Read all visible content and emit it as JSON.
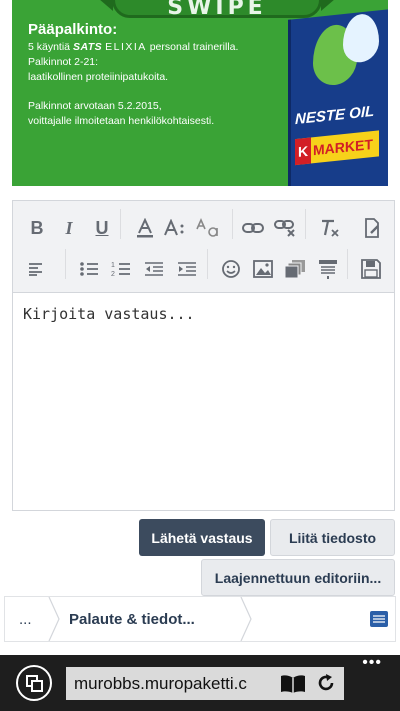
{
  "banner": {
    "swipe_label": "SWIPE",
    "title": "Pääpalkinto:",
    "prize_line_prefix": "5 käyntiä",
    "prize_brand1": "SATS",
    "prize_brand2": "ELIXIA",
    "prize_line_suffix": "personal trainerilla.",
    "prizes_2_21_label": "Palkinnot 2-21:",
    "prizes_2_21_text": "laatikollinen proteiinipatukoita.",
    "draw_line1": "Palkinnot arvotaan 5.2.2015,",
    "draw_line2": "voittajalle ilmoitetaan henkilökohtaisesti.",
    "sign_brand1": "NESTE OIL",
    "sign_brand2_k": "K",
    "sign_brand2": "MARKET"
  },
  "editor": {
    "placeholder": "Kirjoita vastaus...",
    "toolbar": {
      "bold": "B",
      "italic": "I",
      "underline": "U"
    }
  },
  "actions": {
    "submit": "Lähetä vastaus",
    "attach": "Liitä tiedosto",
    "extended": "Laajennettuun editoriin..."
  },
  "breadcrumb": {
    "ellipsis": "...",
    "current": "Palaute & tiedot..."
  },
  "browser": {
    "url": "murobbs.muropaketti.c",
    "more": "•••"
  },
  "colors": {
    "banner_green": "#3aa336",
    "primary_button": "#3c4b5e",
    "browser_bar": "#1e1e1e"
  }
}
